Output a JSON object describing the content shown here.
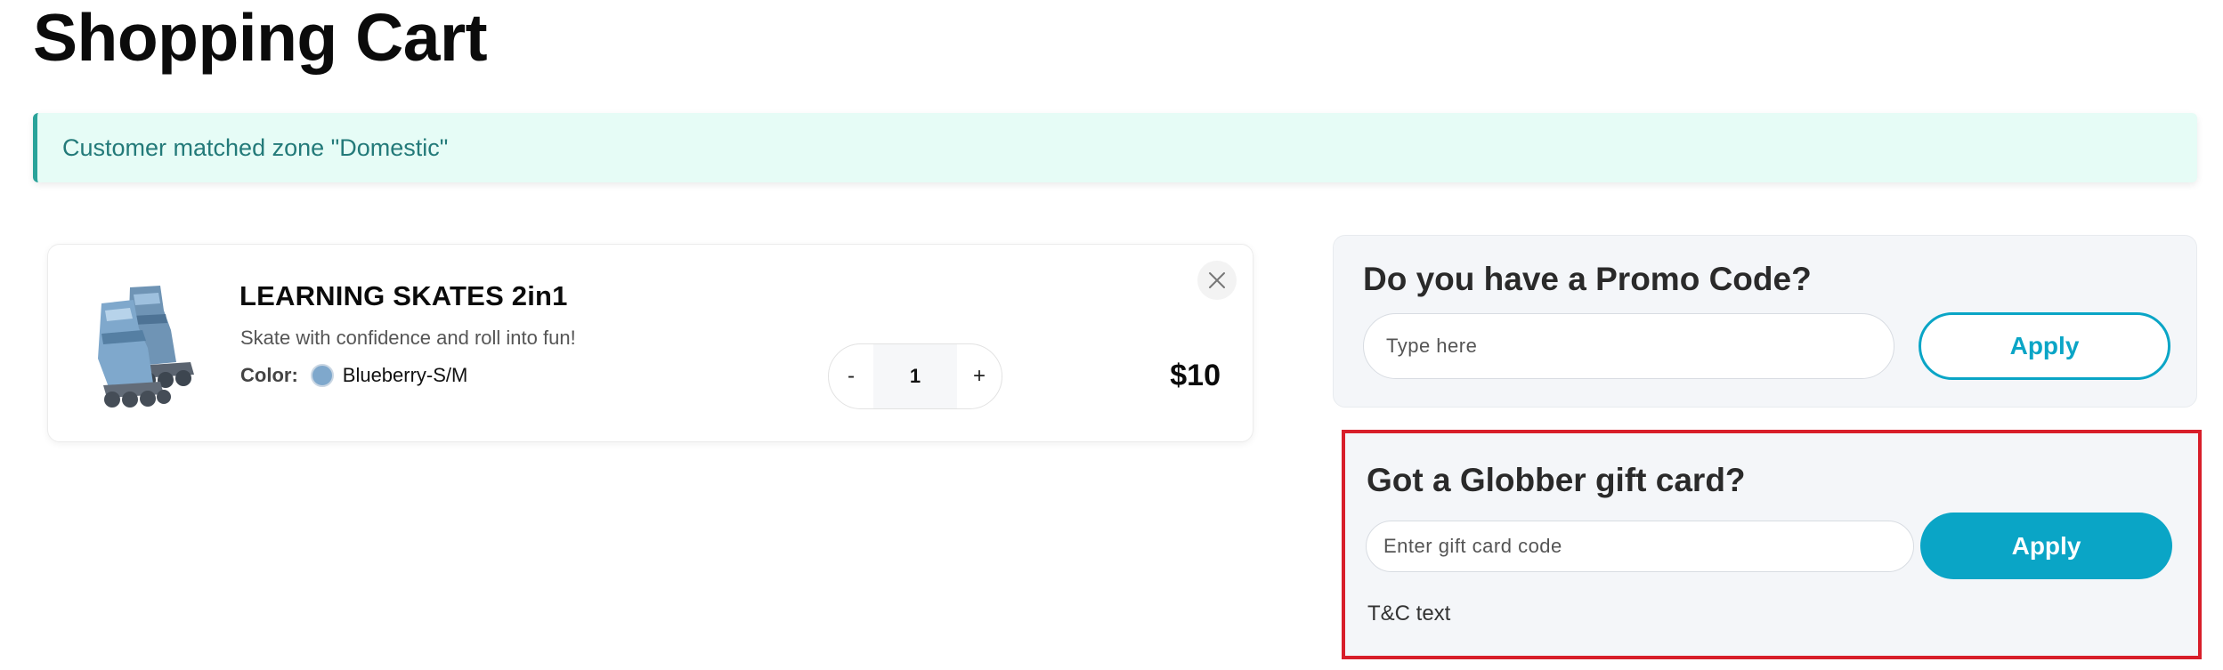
{
  "page": {
    "title": "Shopping Cart"
  },
  "notice": {
    "text": "Customer matched zone \"Domestic\""
  },
  "cart": {
    "items": [
      {
        "name": "LEARNING SKATES 2in1",
        "description": "Skate with confidence and roll into fun!",
        "color_label": "Color:",
        "color_value": "Blueberry-S/M",
        "color_swatch": "#7fa8cc",
        "quantity": "1",
        "decrement_label": "-",
        "increment_label": "+",
        "price": "$10"
      }
    ]
  },
  "promo": {
    "title": "Do you have a Promo Code?",
    "placeholder": "Type here",
    "apply_label": "Apply"
  },
  "gift_card": {
    "title": "Got a Globber gift card?",
    "placeholder": "Enter gift card code",
    "apply_label": "Apply",
    "tc_text": "T&C text"
  },
  "colors": {
    "accent": "#0aa5c6",
    "notice_bg": "#e6fcf6",
    "notice_border": "#2aa39a",
    "highlight_border": "#d81e2a"
  }
}
